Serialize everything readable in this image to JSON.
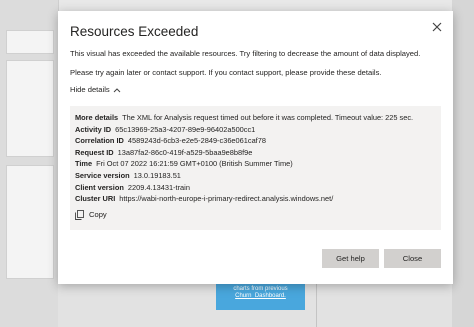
{
  "background": {
    "tile_line1": "charts from previous",
    "tile_line2": "Churn_Dashboard."
  },
  "dialog": {
    "title": "Resources Exceeded",
    "message": "This visual has exceeded the available resources. Try filtering to decrease the amount of data displayed.",
    "support_message": "Please try again later or contact support. If you contact support, please provide these details.",
    "toggle_label": "Hide details",
    "details": [
      {
        "key": "More details",
        "value": "The XML for Analysis request timed out before it was completed. Timeout value: 225 sec."
      },
      {
        "key": "Activity ID",
        "value": "65c13969-25a3-4207-89e9-96402a500cc1"
      },
      {
        "key": "Correlation ID",
        "value": "4589243d-6cb3-e2e5-2849-c36e061caf78"
      },
      {
        "key": "Request ID",
        "value": "13a87fa2-86c0-419f-a529-5baa9e8b8f9e"
      },
      {
        "key": "Time",
        "value": "Fri Oct 07 2022 16:21:59 GMT+0100 (British Summer Time)"
      },
      {
        "key": "Service version",
        "value": "13.0.19183.51"
      },
      {
        "key": "Client version",
        "value": "2209.4.13431-train"
      },
      {
        "key": "Cluster URI",
        "value": "https://wabi-north-europe-i-primary-redirect.analysis.windows.net/"
      }
    ],
    "copy_label": "Copy",
    "get_help_label": "Get help",
    "close_label": "Close"
  },
  "icons": {
    "close": "close-icon",
    "toggle": "chevron-up-icon",
    "copy": "copy-icon"
  }
}
